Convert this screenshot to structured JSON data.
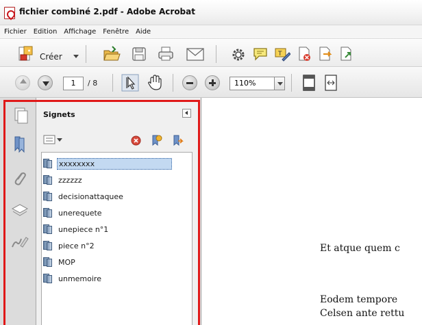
{
  "window": {
    "title": "fichier combiné 2.pdf - Adobe Acrobat",
    "icon": "acrobat-pdf-icon"
  },
  "menu": {
    "items": [
      "Fichier",
      "Edition",
      "Affichage",
      "Fenêtre",
      "Aide"
    ]
  },
  "toolbar": {
    "create_label": "Créer",
    "icons": [
      "create-pdf-icon",
      "open-folder-icon",
      "save-icon",
      "print-icon",
      "email-icon",
      "settings-icon",
      "comment-icon",
      "sign-icon",
      "pdf-delete-icon",
      "pdf-export-icon",
      "pdf-upload-icon"
    ]
  },
  "navigation": {
    "current_page": "1",
    "total_pages": "/ 8",
    "zoom": "110%"
  },
  "panel": {
    "title": "Signets",
    "bookmarks": [
      {
        "label": "xxxxxxxx",
        "selected": true
      },
      {
        "label": "zzzzzz",
        "selected": false
      },
      {
        "label": "decisionattaquee",
        "selected": false
      },
      {
        "label": "unerequete",
        "selected": false
      },
      {
        "label": "unepiece n°1",
        "selected": false
      },
      {
        "label": "piece n°2",
        "selected": false
      },
      {
        "label": "MOP",
        "selected": false
      },
      {
        "label": "unmemoire",
        "selected": false
      }
    ]
  },
  "document": {
    "lines": [
      "Et atque quem c",
      "Eodem tempore",
      "Celsen ante rettu"
    ]
  },
  "colors": {
    "highlight_frame": "#e01818",
    "selection": "#c3d9f1"
  }
}
